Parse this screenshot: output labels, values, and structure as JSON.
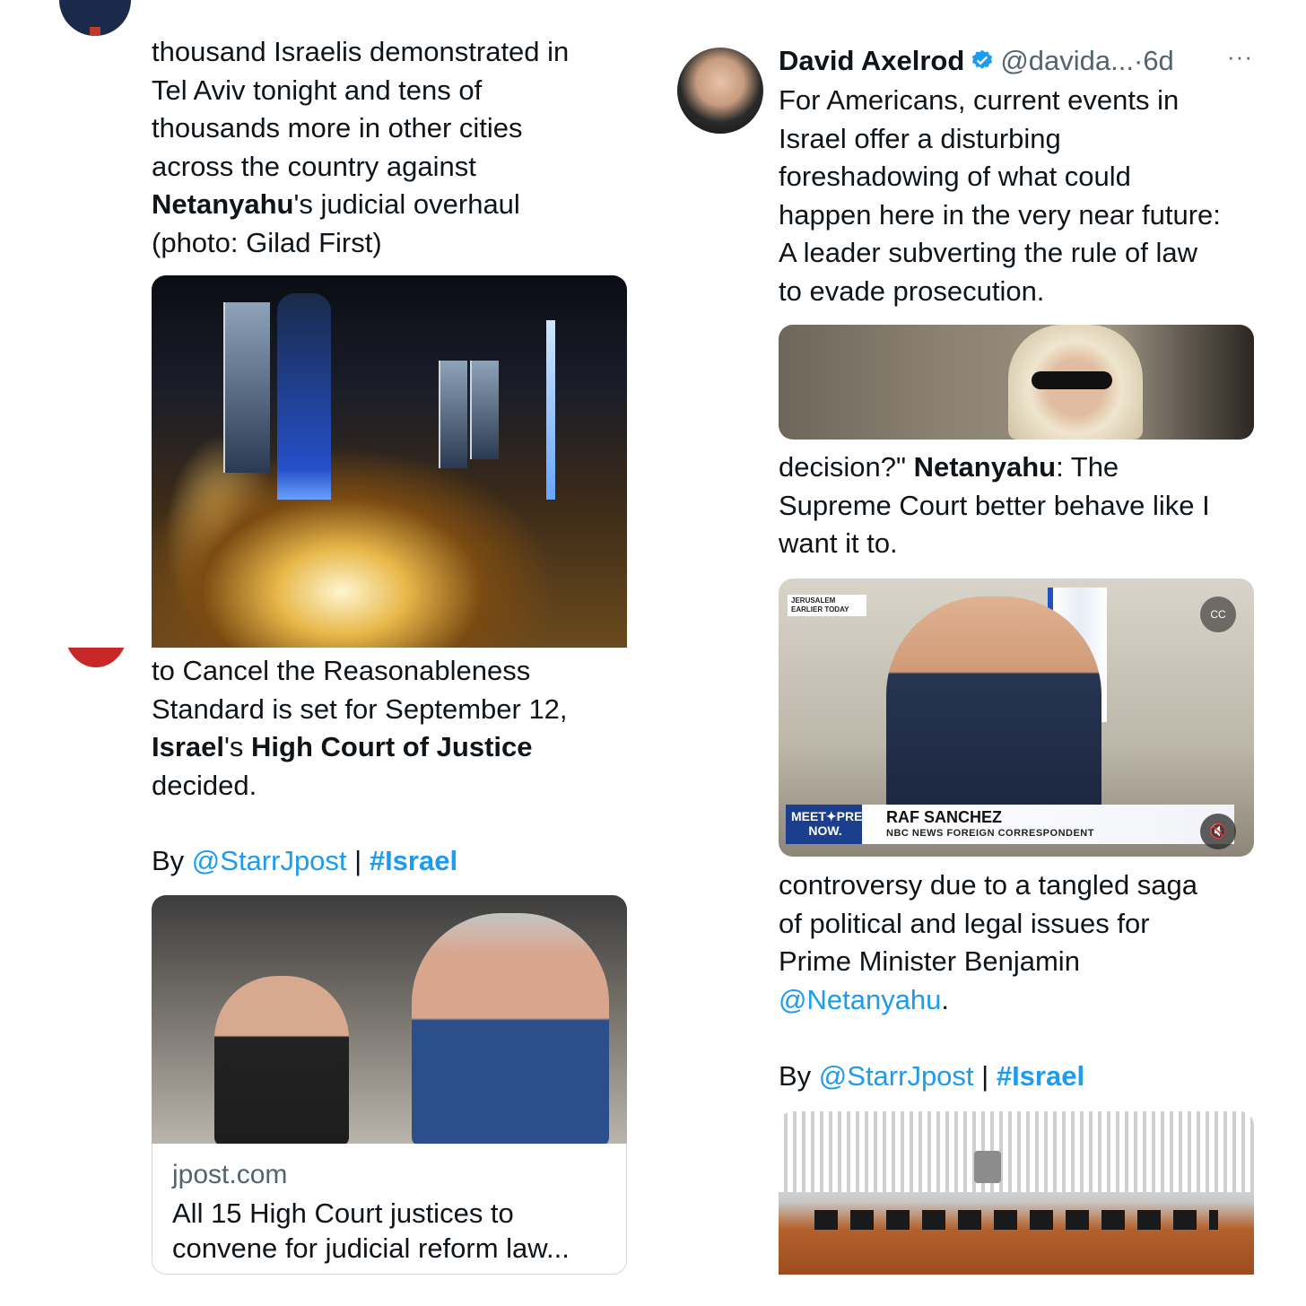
{
  "left_column": {
    "tweet1_text": {
      "line1": "thousand Israelis demonstrated in",
      "line2": "Tel Aviv tonight and tens of",
      "line3": "thousands more in other cities",
      "line4": "across the country against",
      "bold": "Netanyahu",
      "line5_rest": "'s judicial overhaul",
      "line6": "(photo: Gilad First)"
    },
    "tweet2_text": {
      "line1": "to Cancel the Reasonableness",
      "line2": "Standard is set for September 12,",
      "bold1": "Israel",
      "mid": "'s ",
      "bold2": "High Court of Justice",
      "line4": "decided."
    },
    "byline": {
      "prefix": "By ",
      "mention": "@StarrJpost",
      "separator": " | ",
      "hashtag": "#Israel"
    },
    "link_card": {
      "domain": "jpost.com",
      "title": "All 15 High Court justices to convene for judicial reform law..."
    }
  },
  "right_column": {
    "author": {
      "name": "David Axelrod",
      "handle": "@davida...",
      "separator": "·",
      "time": "6d",
      "more": "···"
    },
    "tweet_text": {
      "line1": "For Americans, current events in",
      "line2": "Israel offer a disturbing",
      "line3": "foreshadowing of what could",
      "line4": "happen here in the very near future:",
      "line5": "A leader subverting the rule of law",
      "line6": "to evade prosecution."
    },
    "quote_text": {
      "line1_pre": "decision?\" ",
      "line1_bold": "Netanyahu",
      "line1_post": ": The",
      "line2": "Supreme Court better behave like I",
      "line3": "want it to."
    },
    "video": {
      "top_label_line1": "JERUSALEM",
      "top_label_line2": "EARLIER TODAY",
      "show_line1": "MEET✦PRESS",
      "show_line2": "NOW.",
      "name": "RAF SANCHEZ",
      "title": "NBC NEWS  FOREIGN CORRESPONDENT",
      "cc_icon": "CC",
      "mute_icon": "🔇"
    },
    "tweet3_text": {
      "line1": "controversy due to a tangled saga",
      "line2": "of political and legal issues for",
      "line3": "Prime Minister Benjamin",
      "mention": "@Netanyahu",
      "end": "."
    },
    "byline": {
      "prefix": "By ",
      "mention": "@StarrJpost",
      "separator": " | ",
      "hashtag": "#Israel"
    }
  },
  "colors": {
    "link": "#1d9bf0",
    "text": "#0f1419",
    "secondary": "#536471",
    "border": "#cfd9de"
  }
}
